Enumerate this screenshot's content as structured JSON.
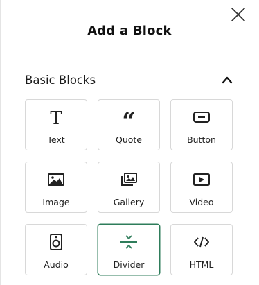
{
  "dialog": {
    "title": "Add a Block",
    "close_icon": "close-icon"
  },
  "section": {
    "title": "Basic Blocks",
    "toggle_icon": "chevron-up-icon",
    "expanded": true
  },
  "blocks": [
    {
      "label": "Text",
      "icon": "text-icon"
    },
    {
      "label": "Quote",
      "icon": "quote-icon"
    },
    {
      "label": "Button",
      "icon": "button-icon"
    },
    {
      "label": "Image",
      "icon": "image-icon"
    },
    {
      "label": "Gallery",
      "icon": "gallery-icon"
    },
    {
      "label": "Video",
      "icon": "video-icon"
    },
    {
      "label": "Audio",
      "icon": "audio-icon"
    },
    {
      "label": "Divider",
      "icon": "divider-icon",
      "selected": true
    },
    {
      "label": "HTML",
      "icon": "code-icon"
    }
  ],
  "colors": {
    "accent": "#2f7d5b",
    "border": "#d8d8d8",
    "text": "#1c1c1c"
  }
}
